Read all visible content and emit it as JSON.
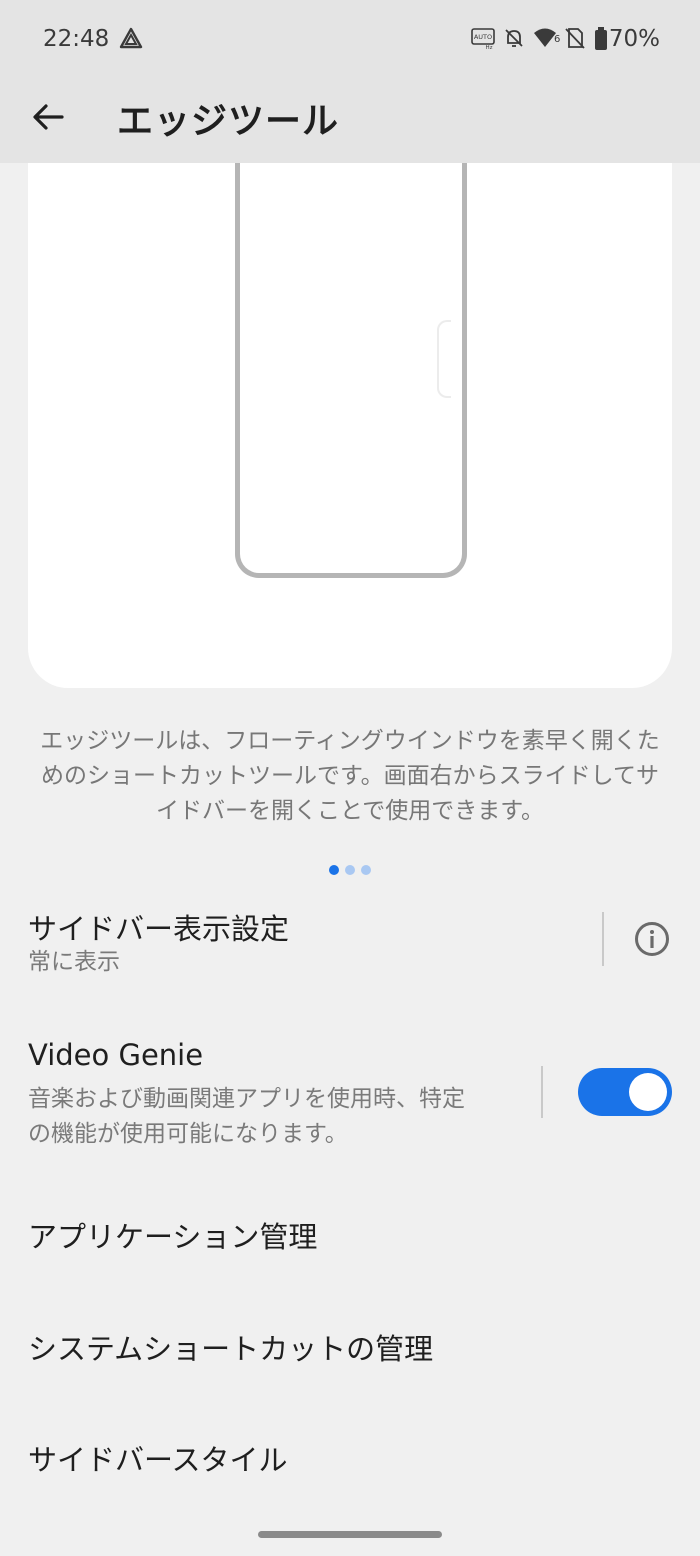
{
  "status_bar": {
    "time": "22:48",
    "battery_percent": "70%",
    "icons": [
      "navigation-icon",
      "auto-hz-icon",
      "mute-bell-icon",
      "wifi-6-icon",
      "no-sim-icon",
      "battery-icon"
    ]
  },
  "app_bar": {
    "title": "エッジツール",
    "back_icon": "arrow-back-icon"
  },
  "preview": {
    "description": "エッジツールは、フローティングウインドウを素早く開くためのショートカットツールです。画面右からスライドしてサイドバーを開くことで使用できます。",
    "page_count": 3,
    "active_page": 1
  },
  "settings": {
    "sidebar_display": {
      "title": "サイドバー表示設定",
      "value": "常に表示"
    },
    "video_genie": {
      "title": "Video Genie",
      "description": "音楽および動画関連アプリを使用時、特定の機能が使用可能になります。",
      "enabled": true
    },
    "app_management": {
      "title": "アプリケーション管理"
    },
    "system_shortcuts": {
      "title": "システムショートカットの管理"
    },
    "sidebar_style": {
      "title": "サイドバースタイル"
    }
  },
  "colors": {
    "accent": "#1a73e8",
    "dot_inactive": "#a9c8f2",
    "background": "#f0f0f0",
    "app_bar": "#e4e4e4"
  }
}
